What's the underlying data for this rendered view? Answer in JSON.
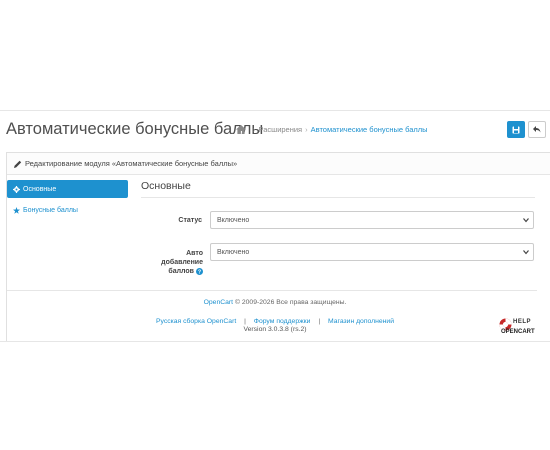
{
  "header": {
    "title": "Автоматические бонусные баллы",
    "breadcrumb": {
      "item1": "Расширения",
      "item2": "Автоматические бонусные баллы",
      "sep": "›"
    }
  },
  "panel": {
    "heading": "Редактирование модуля «Автоматические бонусные баллы»"
  },
  "sidebar": {
    "items": [
      {
        "label": "Основные",
        "icon": "gear-icon",
        "active": true
      },
      {
        "label": "Бонусные баллы",
        "icon": "star-icon",
        "active": false
      }
    ]
  },
  "form": {
    "section_title": "Основные",
    "status_label": "Статус",
    "status_value": "Включено",
    "auto_label_line1": "Авто",
    "auto_label_line2": "добавление",
    "auto_label_line3": "баллов",
    "auto_value": "Включено"
  },
  "footer": {
    "opencart": "OpenCart",
    "copyright": "© 2009-2026 Все права защищены.",
    "link1": "Русская сборка OpenCart",
    "link2": "Форум поддержки",
    "link3": "Магазин дополнений",
    "divider": "|",
    "version": "Version 3.0.3.8 (rs.2)"
  },
  "logo": {
    "top": "HELP",
    "bottom": "OPENCART"
  },
  "colors": {
    "accent": "#1e91cf",
    "text": "#444444"
  }
}
